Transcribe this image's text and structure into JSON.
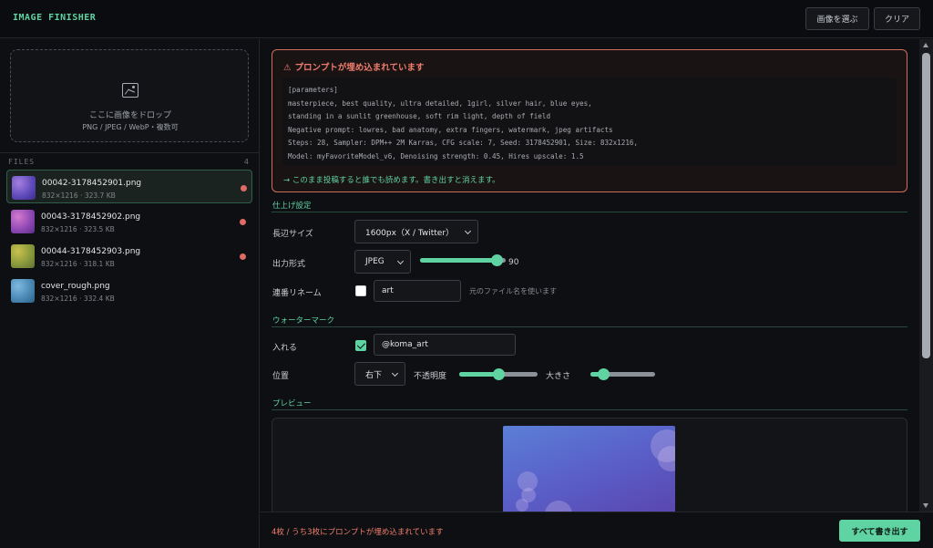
{
  "app": {
    "title": "IMAGE FINISHER"
  },
  "header": {
    "pick_label": "画像を選ぶ",
    "clear_label": "クリア"
  },
  "dropzone": {
    "title": "ここに画像をドロップ",
    "subtitle": "PNG / JPEG / WebP・複数可",
    "icon": "image-icon"
  },
  "files": {
    "label": "FILES",
    "count": "4",
    "items": [
      {
        "name": "00042-3178452901.png",
        "meta": "832×1216 · 323.7 KB",
        "has_prompt": true,
        "active": true
      },
      {
        "name": "00043-3178452902.png",
        "meta": "832×1216 · 323.5 KB",
        "has_prompt": true,
        "active": false
      },
      {
        "name": "00044-3178452903.png",
        "meta": "832×1216 · 318.1 KB",
        "has_prompt": true,
        "active": false
      },
      {
        "name": "cover_rough.png",
        "meta": "832×1216 · 332.4 KB",
        "has_prompt": false,
        "active": false
      }
    ]
  },
  "warning": {
    "title": "プロンプトが埋め込まれています",
    "icon": "warning-icon",
    "lines": [
      "[parameters]",
      "masterpiece, best quality, ultra detailed, 1girl, silver hair, blue eyes,",
      "standing in a sunlit greenhouse, soft rim light, depth of field",
      "Negative prompt: lowres, bad anatomy, extra fingers, watermark, jpeg artifacts",
      "Steps: 28, Sampler: DPM++ 2M Karras, CFG scale: 7, Seed: 3178452901, Size: 832x1216,",
      "Model: myFavoriteModel_v6, Denoising strength: 0.45, Hires upscale: 1.5"
    ],
    "note": "→ このまま投稿すると誰でも読めます。書き出すと消えます。"
  },
  "finish": {
    "section": "仕上げ設定",
    "long_side_label": "長辺サイズ",
    "long_side_value": "1600px（X / Twitter）",
    "format_label": "出力形式",
    "format_value": "JPEG",
    "quality": 90,
    "quality_max": 100,
    "rename_label": "連番リネーム",
    "rename_checked": false,
    "rename_value": "art",
    "rename_hint": "元のファイル名を使います"
  },
  "watermark": {
    "section": "ウォーターマーク",
    "enable_label": "入れる",
    "enabled": true,
    "text_value": "@koma_art",
    "position_label": "位置",
    "position_value": "右下",
    "opacity_label": "不透明度",
    "opacity": 0.5,
    "size_label": "大きさ",
    "size": 0.2
  },
  "preview": {
    "section": "プレビュー"
  },
  "footer": {
    "status": "4枚 / うち3枚にプロンプトが埋め込まれています",
    "export_label": "すべて書き出す"
  },
  "colors": {
    "accent": "#5fd3a1",
    "danger": "#ef7d6d",
    "background": "#0e0f12"
  }
}
